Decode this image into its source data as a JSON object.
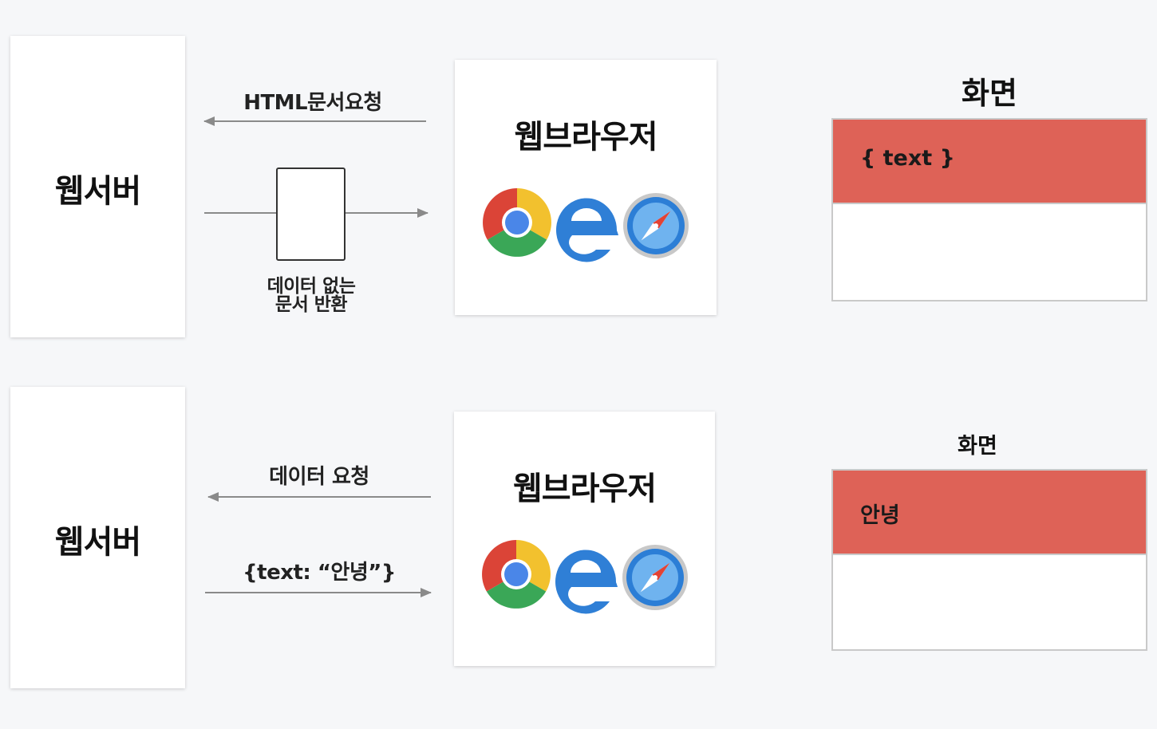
{
  "top": {
    "server": {
      "label": "웹서버"
    },
    "request_label": "HTML문서요청",
    "response_label_line1": "데이터 없는",
    "response_label_line2": "문서 반환",
    "browser": {
      "title": "웹브라우저",
      "icons": [
        "chrome-icon",
        "edge-icon",
        "safari-icon"
      ]
    },
    "screen": {
      "title": "화면",
      "bar_text": "{ text }"
    }
  },
  "bottom": {
    "server": {
      "label": "웹서버"
    },
    "request_label": "데이터 요청",
    "response_label": "{text: “안녕”}",
    "browser": {
      "title": "웹브라우저",
      "icons": [
        "chrome-icon",
        "edge-icon",
        "safari-icon"
      ]
    },
    "screen": {
      "title": "화면",
      "bar_text": "안녕"
    }
  },
  "colors": {
    "screen_bar": "#de6257",
    "arrow": "#8a8a8a",
    "background": "#f6f7f9"
  }
}
